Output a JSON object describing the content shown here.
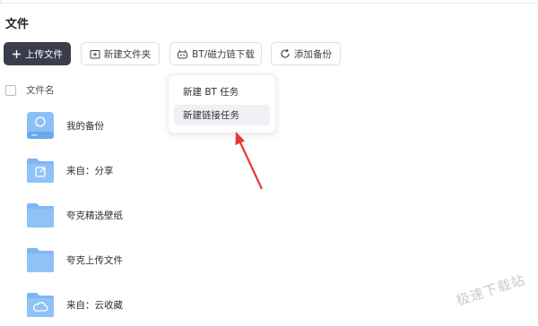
{
  "page": {
    "title": "文件"
  },
  "toolbar": {
    "upload_label": "上传文件",
    "new_folder_label": "新建文件夹",
    "bt_label": "BT/磁力链下载",
    "backup_label": "添加备份"
  },
  "list": {
    "header_label": "文件名",
    "items": [
      {
        "name": "我的备份",
        "icon": "backup-drive-icon"
      },
      {
        "name": "来自：分享",
        "icon": "shared-folder-icon"
      },
      {
        "name": "夸克精选壁纸",
        "icon": "folder-icon"
      },
      {
        "name": "夸克上传文件",
        "icon": "folder-icon"
      },
      {
        "name": "来自：云收藏",
        "icon": "cloud-folder-icon"
      }
    ]
  },
  "dropdown": {
    "items": [
      {
        "label": "新建 BT 任务"
      },
      {
        "label": "新建链接任务",
        "highlighted": true
      }
    ]
  },
  "watermark": "极速下载站",
  "colors": {
    "primary_button": "#3a3e4c",
    "folder_blue": "#7fb6f2",
    "annotation_arrow": "#e53935"
  }
}
